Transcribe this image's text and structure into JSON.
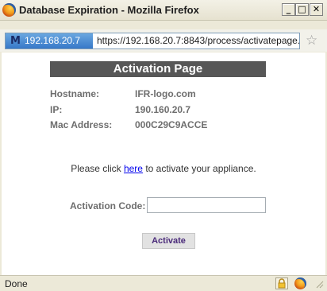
{
  "window": {
    "title": "Database Expiration - Mozilla Firefox",
    "min_label": "_",
    "max_label": "□",
    "close_label": "✕"
  },
  "urlbar": {
    "site_identity": "192.168.20.7",
    "url": "https://192.168.20.7:8843/process/activatepage.c"
  },
  "page": {
    "header": "Activation Page",
    "info": [
      {
        "label": "Hostname:",
        "value": "IFR-logo.com"
      },
      {
        "label": "IP:",
        "value": "190.160.20.7"
      },
      {
        "label": "Mac Address:",
        "value": "000C29C9ACCE"
      }
    ],
    "activate_prefix": "Please click ",
    "activate_link": "here",
    "activate_suffix": " to activate your appliance.",
    "code_label": "Activation Code:",
    "code_value": "",
    "activate_button": "Activate"
  },
  "status": {
    "text": "Done"
  }
}
